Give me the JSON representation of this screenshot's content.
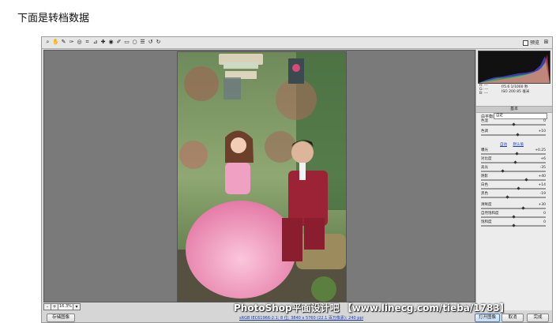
{
  "page": {
    "heading": "下面是转档数据"
  },
  "toolbar": {
    "tools": [
      "zoom-icon",
      "hand-icon",
      "white-balance-icon",
      "color-sampler-icon",
      "target-adjust-icon",
      "crop-icon",
      "straighten-icon",
      "spot-removal-icon",
      "red-eye-icon",
      "adjustment-brush-icon",
      "graduated-filter-icon",
      "radial-filter-icon",
      "preferences-icon",
      "rotate-ccw-icon",
      "rotate-cw-icon"
    ],
    "preview_label": "预览"
  },
  "zoom": {
    "value": "16.3%",
    "minus": "-",
    "plus": "+"
  },
  "bottom": {
    "save_label": "存储图像",
    "info_link": "sRGB IEC61966-2.1; 8 位; 3840 x 5760 (22.1 百万像素); 240 ppi",
    "open_label": "打开图像",
    "cancel_label": "取消",
    "done_label": "完成"
  },
  "watermark": "PhotoShop平面设计吧 【www.linecg.com/tieba/1783】",
  "panel": {
    "readout": {
      "r": "R: ---",
      "g": "G: ---",
      "b": "B: ---",
      "exposure": "f/5.6  1/1000 秒",
      "iso": "ISO 200  85 毫米"
    },
    "title": "基本",
    "wb_label": "白平衡:",
    "wb_value": "自定",
    "sliders": [
      {
        "label": "色温",
        "value": "0",
        "pos": 0.5
      },
      {
        "label": "色调",
        "value": "+10",
        "pos": 0.56
      },
      {
        "label": "曝光",
        "value": "+0.25",
        "pos": 0.55
      },
      {
        "label": "对比度",
        "value": "+6",
        "pos": 0.53
      },
      {
        "label": "高光",
        "value": "-35",
        "pos": 0.33
      },
      {
        "label": "阴影",
        "value": "+40",
        "pos": 0.7
      },
      {
        "label": "白色",
        "value": "+14",
        "pos": 0.57
      },
      {
        "label": "黑色",
        "value": "-19",
        "pos": 0.4
      },
      {
        "label": "清晰度",
        "value": "+30",
        "pos": 0.65
      },
      {
        "label": "自然饱和度",
        "value": "0",
        "pos": 0.5
      },
      {
        "label": "饱和度",
        "value": "0",
        "pos": 0.5
      }
    ],
    "link_auto": "自动",
    "link_default": "默认值"
  },
  "colors": {
    "canvas": "#7a7a7a",
    "panel": "#ececec",
    "dress": "#f4a9c8",
    "suit": "#9c2336"
  }
}
